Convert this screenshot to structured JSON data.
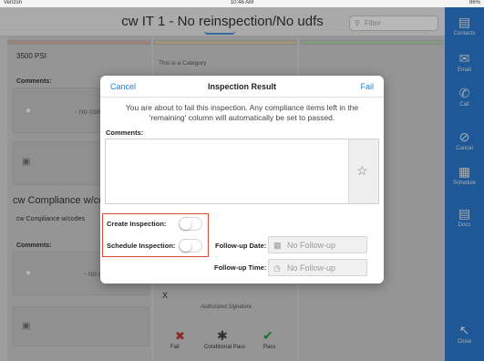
{
  "status_bar": {
    "carrier": "Verizon",
    "time": "10:46 AM",
    "battery": "86%"
  },
  "header": {
    "title": "cw IT 1 - No reinspection/No udfs",
    "search_placeholder": "Filter"
  },
  "sidebar": {
    "items": [
      {
        "label": "Contacts",
        "icon": "contacts-icon"
      },
      {
        "label": "Email",
        "icon": "email-icon"
      },
      {
        "label": "Call",
        "icon": "phone-icon"
      },
      {
        "label": "Cancel",
        "icon": "cancel-icon"
      },
      {
        "label": "Schedule",
        "icon": "calendar-icon"
      },
      {
        "label": "Docs",
        "icon": "document-icon"
      },
      {
        "label": "Close",
        "icon": "arrow-icon"
      }
    ]
  },
  "background": {
    "psi_text": "3500 PSI",
    "comments_label": "Comments:",
    "no_comments": "- no comments -",
    "category_text": "This is a Category",
    "compliance_title": "cw Compliance w/codes",
    "compliance_sub": "cw Compliance w/codes",
    "signature_x": "X",
    "signature_label": "Authorized Signature",
    "actions": [
      "Fail",
      "Conditional Pass",
      "Pass"
    ]
  },
  "modal": {
    "cancel_label": "Cancel",
    "title": "Inspection Result",
    "fail_label": "Fail",
    "message": "You are about to fail this inspection. Any compliance items left in the 'remaining' column will automatically be set to passed.",
    "comments_label": "Comments:",
    "create_inspection_label": "Create Inspection:",
    "schedule_inspection_label": "Schedule Inspection:",
    "followup_date_label": "Follow-up Date:",
    "followup_date_placeholder": "No Follow-up",
    "followup_time_label": "Follow-up Time:",
    "followup_time_placeholder": "No Follow-up",
    "create_inspection_on": false,
    "schedule_inspection_on": false
  },
  "colors": {
    "accent": "#2a7bd0",
    "highlight": "#e04a3a"
  }
}
